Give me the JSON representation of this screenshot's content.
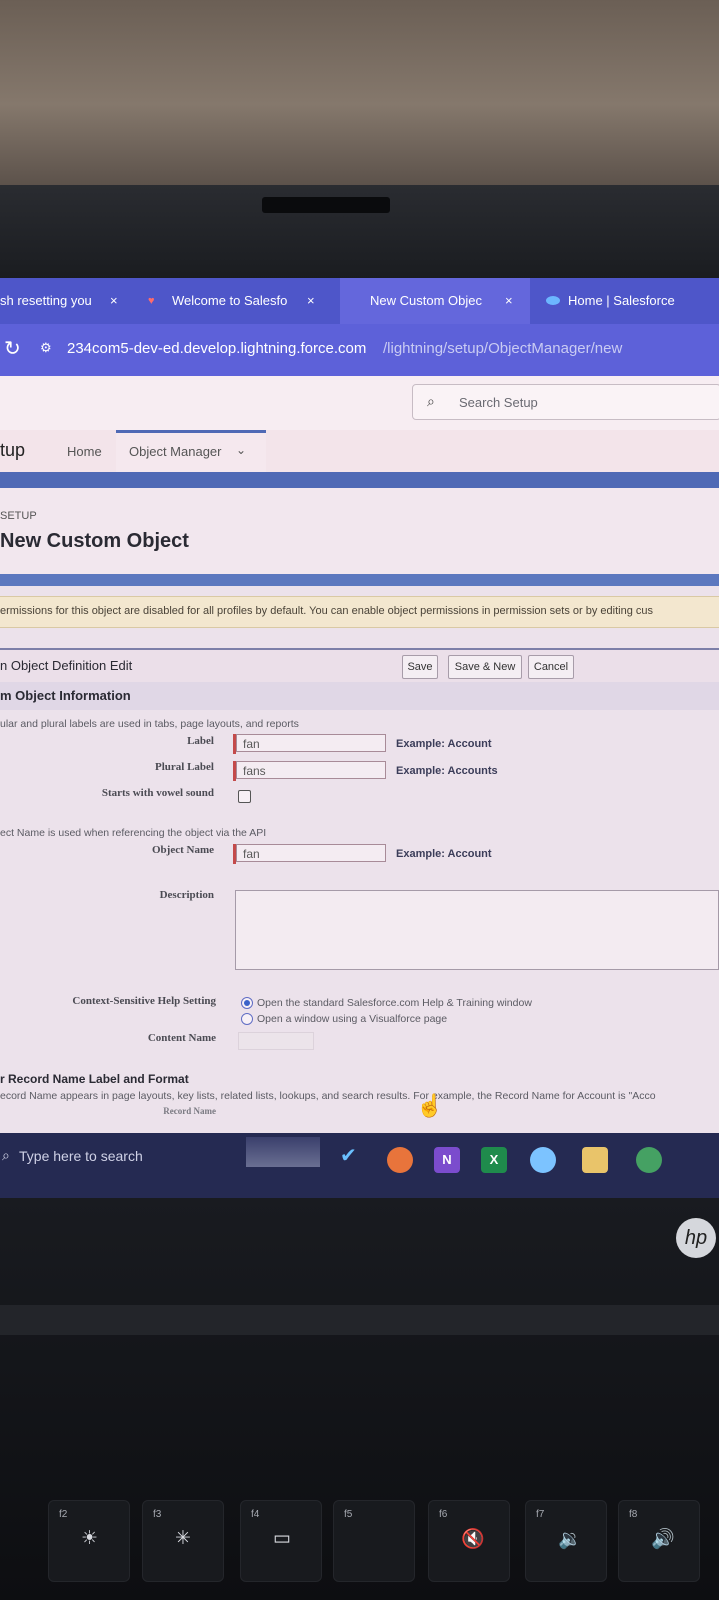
{
  "browser": {
    "tabs": [
      {
        "title": "sh resetting you",
        "close": "×"
      },
      {
        "title": "Welcome to Salesfo",
        "close": "×"
      },
      {
        "title": "New Custom Objec",
        "close": "×"
      },
      {
        "title": "Home | Salesforce"
      }
    ],
    "url_host": "234com5-dev-ed.develop.lightning.force.com",
    "url_path": "/lightning/setup/ObjectManager/new"
  },
  "setup_header": {
    "search_placeholder": "Search Setup",
    "app_name": "tup",
    "nav": {
      "home": "Home",
      "object_manager": "Object Manager"
    }
  },
  "page": {
    "breadcrumb": "SETUP",
    "title": "New Custom Object"
  },
  "banner": {
    "text": "ermissions for this object are disabled for all profiles by default. You can enable object permissions in permission sets or by editing cus"
  },
  "form": {
    "header": "n Object Definition Edit",
    "buttons": {
      "save": "Save",
      "save_new": "Save & New",
      "cancel": "Cancel"
    },
    "section_title": "m Object Information",
    "labels_note": "ular and plural labels are used in tabs, page layouts, and reports",
    "label": {
      "name": "Label",
      "value": "fan",
      "example": "Example:  Account"
    },
    "plural": {
      "name": "Plural Label",
      "value": "fans",
      "example": "Example:  Accounts"
    },
    "vowel": {
      "name": "Starts with vowel sound",
      "checked": false
    },
    "api_note": "ect Name is used when referencing the object via the API",
    "object_name": {
      "name": "Object Name",
      "value": "fan",
      "example": "Example:  Account"
    },
    "description": {
      "name": "Description",
      "value": ""
    },
    "help": {
      "name": "Context-Sensitive Help Setting",
      "opt1": "Open the standard Salesforce.com Help & Training window",
      "opt2": "Open a window using a Visualforce page"
    },
    "content_name": {
      "name": "Content Name"
    },
    "record_section": "r Record Name Label and Format",
    "record_note": "ecord Name appears in page layouts, key lists, related lists, lookups, and search results. For example, the Record Name for Account is \"Acco",
    "record_name_label": "Record Name"
  },
  "taskbar": {
    "search_placeholder": "Type here to search"
  },
  "keyboard": {
    "keys": [
      {
        "fn": "f2",
        "icon": "☀"
      },
      {
        "fn": "f3",
        "icon": "✳"
      },
      {
        "fn": "f4",
        "icon": "▭"
      },
      {
        "fn": "f5",
        "icon": ""
      },
      {
        "fn": "f6",
        "icon": "🔇"
      },
      {
        "fn": "f7",
        "icon": "🔉"
      },
      {
        "fn": "f8",
        "icon": "🔊"
      }
    ]
  },
  "colors": {
    "tab_strip": "#4e56c9",
    "address_bar": "#5d61d9",
    "salesforce_blue": "#4f69b5",
    "warning_bg": "#f3e7cf",
    "required_bar": "#c44a4a",
    "taskbar": "#252a52"
  }
}
